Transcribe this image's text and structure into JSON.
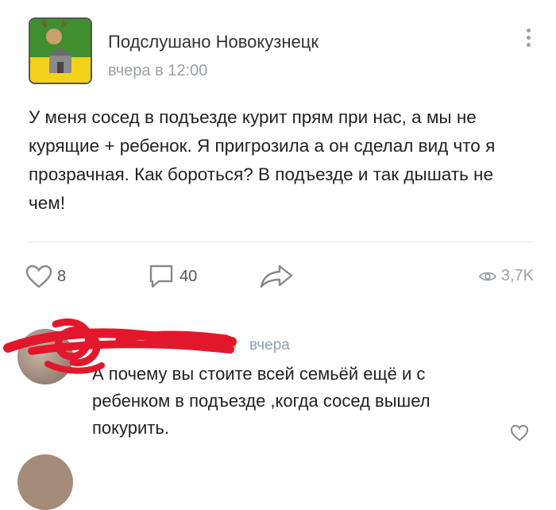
{
  "post": {
    "author": "Подслушано Новокузнецк",
    "time": "вчера в 12:00",
    "text": "У меня сосед в подъезде курит прям при нас, а мы не курящие + ребенок. Я пригрозила а он сделал вид что я прозрачная. Как бороться? В подъезде и так дышать не чем!",
    "likes": "8",
    "comments": "40",
    "views": "3,7K"
  },
  "comment": {
    "author": "",
    "time": "вчера",
    "text": "А почему вы стоите всей семьёй ещё и с ребенком в подъезде ,когда сосед вышел покурить."
  },
  "icons": {
    "like": "heart-icon",
    "comment": "comment-bubble-icon",
    "share": "share-arrow-icon",
    "views": "eye-icon",
    "more": "more-vertical-icon"
  },
  "colors": {
    "accent": "#9aa0a6",
    "scribble": "#e3172b",
    "time": "#8fa2b8"
  }
}
